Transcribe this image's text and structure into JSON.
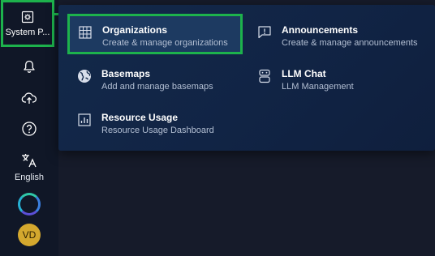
{
  "sidebar": {
    "system_label": "System P...",
    "language_label": "English",
    "avatar_initials": "VD"
  },
  "menu": {
    "organizations": {
      "title": "Organizations",
      "desc": "Create & manage organizations"
    },
    "announcements": {
      "title": "Announcements",
      "desc": "Create & manage announcements"
    },
    "basemaps": {
      "title": "Basemaps",
      "desc": "Add and manage basemaps"
    },
    "llm_chat": {
      "title": "LLM Chat",
      "desc": "LLM Management"
    },
    "resource_usage": {
      "title": "Resource Usage",
      "desc": "Resource Usage Dashboard"
    }
  },
  "colors": {
    "highlight": "#1db24c",
    "panel": "#13294a",
    "sidebar": "#101727",
    "avatar": "#d4a82e"
  },
  "icons": [
    "settings-icon",
    "bell-icon",
    "cloud-upload-icon",
    "help-icon",
    "translate-icon",
    "loading-icon",
    "table-icon",
    "announcement-icon",
    "globe-icon",
    "bot-icon",
    "chart-icon"
  ]
}
